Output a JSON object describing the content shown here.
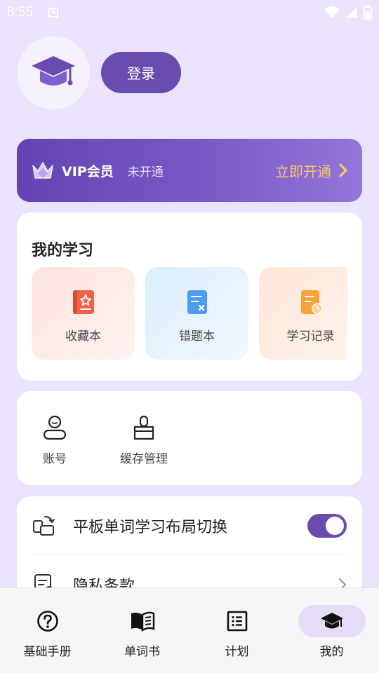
{
  "status_bar": {
    "time": "8:55",
    "notification_icon": "a-icon",
    "wifi_icon": "wifi-icon",
    "signal_icon": "signal-icon",
    "battery_icon": "battery-icon"
  },
  "profile": {
    "avatar_icon": "graduation-cap-icon",
    "login_label": "登录"
  },
  "vip": {
    "title": "VIP会员",
    "status": "未开通",
    "cta": "立即开通",
    "cta_color": "#f7c86a"
  },
  "my_study": {
    "title": "我的学习",
    "items": [
      {
        "label": "收藏本",
        "icon": "favorites-book-icon"
      },
      {
        "label": "错题本",
        "icon": "mistakes-book-icon"
      },
      {
        "label": "学习记录",
        "icon": "study-record-icon"
      }
    ]
  },
  "tools": [
    {
      "label": "账号",
      "icon": "account-icon"
    },
    {
      "label": "缓存管理",
      "icon": "brush-icon"
    }
  ],
  "settings": {
    "layout_toggle": {
      "label": "平板单词学习布局切换",
      "enabled": true,
      "icon": "switch-layout-icon"
    },
    "privacy": {
      "label": "隐私条款",
      "icon": "privacy-icon"
    }
  },
  "tabs": [
    {
      "label": "基础手册",
      "icon": "help-circle-icon",
      "active": false
    },
    {
      "label": "单词书",
      "icon": "open-book-icon",
      "active": false
    },
    {
      "label": "计划",
      "icon": "list-icon",
      "active": false
    },
    {
      "label": "我的",
      "icon": "graduation-cap-icon",
      "active": true
    }
  ],
  "colors": {
    "accent": "#6a4bb0",
    "background": "#ebe3fb"
  }
}
